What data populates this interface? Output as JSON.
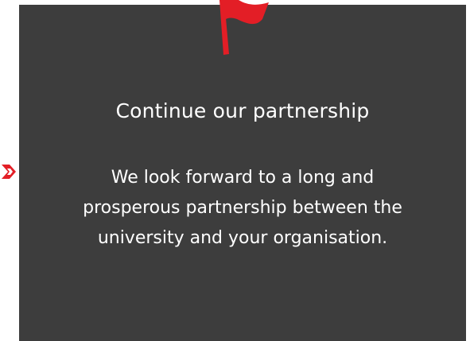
{
  "section": {
    "title": "Continue our partnership",
    "body_lines": [
      "We look forward to a long and",
      "prosperous partnership between the",
      "university and your organisation."
    ]
  },
  "icons": {
    "flag": "flag-icon",
    "arrow": "chevron-right-icon"
  },
  "colors": {
    "card_background": "#3d3d3d",
    "accent": "#e31e26",
    "text": "#ffffff"
  }
}
